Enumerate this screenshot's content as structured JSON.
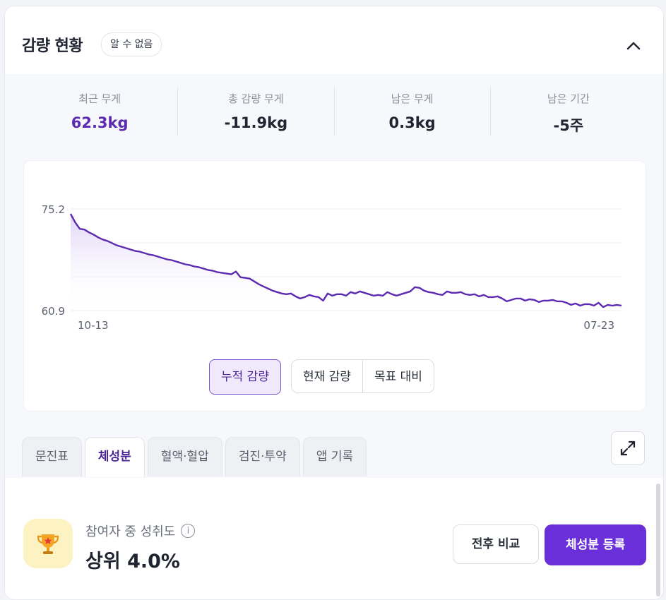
{
  "header": {
    "title": "감량 현황",
    "badge": "알 수 없음",
    "collapse_icon": "chevron-up-icon"
  },
  "stats": [
    {
      "label": "최근 무게",
      "value": "62.3kg"
    },
    {
      "label": "총 감량 무게",
      "value": "-11.9kg"
    },
    {
      "label": "남은 무게",
      "value": "0.3kg"
    },
    {
      "label": "남은 기간",
      "value": "-5주"
    }
  ],
  "colors": {
    "accent": "#6a2fd8",
    "accent_text": "#5b2ab0",
    "line": "#5b2ab0",
    "fill": "#efe9fb"
  },
  "chart_data": {
    "type": "area",
    "x_start_label": "10-13",
    "x_end_label": "07-23",
    "yticks": [
      "75.2",
      "60.9"
    ],
    "ylim": [
      60.9,
      75.2
    ],
    "grid": true,
    "y": [
      74.5,
      73.3,
      72.4,
      72.3,
      71.9,
      71.6,
      71.2,
      70.9,
      70.7,
      70.4,
      70.1,
      69.9,
      69.7,
      69.5,
      69.3,
      69.2,
      69.0,
      68.8,
      68.7,
      68.5,
      68.3,
      68.1,
      68.0,
      67.8,
      67.6,
      67.4,
      67.3,
      67.1,
      67.0,
      66.8,
      66.6,
      66.5,
      66.3,
      66.2,
      66.1,
      66.0,
      66.4,
      65.6,
      65.5,
      65.4,
      65.0,
      64.6,
      64.3,
      64.0,
      63.7,
      63.5,
      63.3,
      63.2,
      63.3,
      62.9,
      62.6,
      62.8,
      63.1,
      62.9,
      62.8,
      62.3,
      63.3,
      63.0,
      63.2,
      63.2,
      63.0,
      63.5,
      63.3,
      63.6,
      63.4,
      63.2,
      63.0,
      63.1,
      63.0,
      63.5,
      63.2,
      63.0,
      63.2,
      63.4,
      63.6,
      64.2,
      64.1,
      63.7,
      63.5,
      63.4,
      63.2,
      63.1,
      63.6,
      63.4,
      63.4,
      63.5,
      63.2,
      63.1,
      63.2,
      62.9,
      63.1,
      62.8,
      62.8,
      62.9,
      62.6,
      62.2,
      62.4,
      62.6,
      62.6,
      62.3,
      62.5,
      62.4,
      62.1,
      62.3,
      62.3,
      62.4,
      62.2,
      62.2,
      62.0,
      61.7,
      61.9,
      61.6,
      61.8,
      61.8,
      61.6,
      62.0,
      61.4,
      61.7,
      61.6,
      61.7,
      61.6
    ],
    "toggle_buttons": [
      "누적 감량",
      "현재 감량",
      "목표 대비"
    ],
    "active_toggle": "누적 감량"
  },
  "tabs": [
    {
      "label": "문진표"
    },
    {
      "label": "체성분",
      "active": true
    },
    {
      "label": "혈액·혈압"
    },
    {
      "label": "검진·투약"
    },
    {
      "label": "앱 기록"
    }
  ],
  "expand_icon": "expand-icon",
  "achievement": {
    "icon": "trophy-icon",
    "label": "참여자 중 성취도",
    "info_icon": "info-icon",
    "value": "상위 4.0%"
  },
  "buttons": {
    "compare": "전후 비교",
    "register": "체성분 등록"
  }
}
